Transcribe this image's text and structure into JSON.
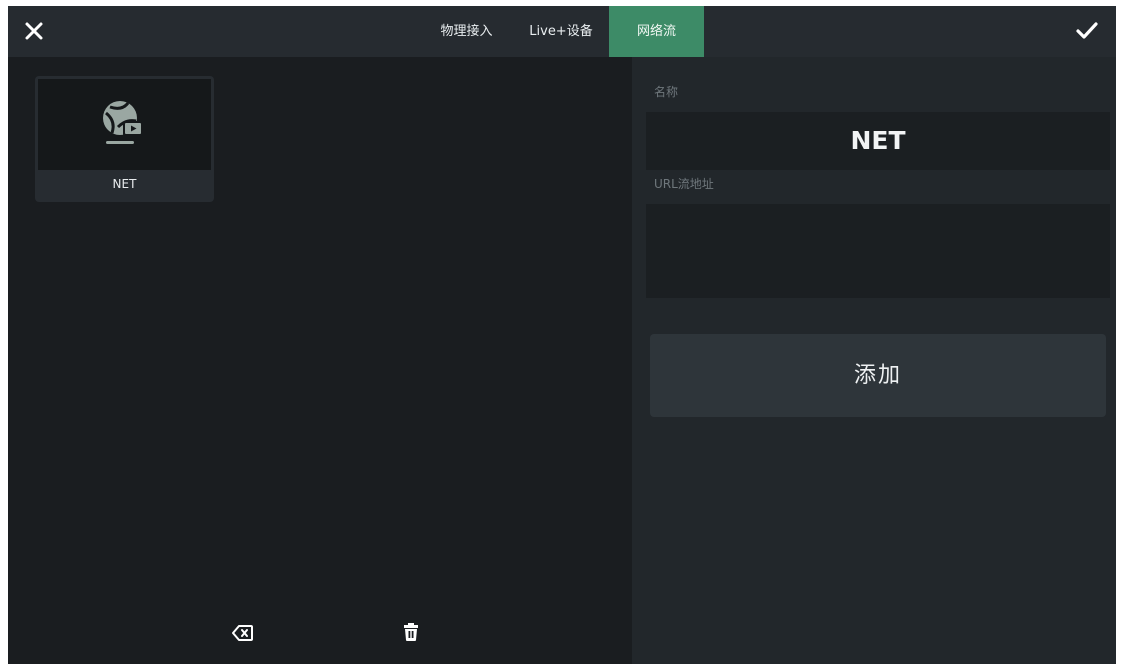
{
  "header": {
    "close_icon": "close-icon",
    "confirm_icon": "check-icon",
    "tabs": [
      {
        "label": "物理接入",
        "active": false
      },
      {
        "label": "Live+设备",
        "active": false
      },
      {
        "label": "网络流",
        "active": true
      }
    ]
  },
  "sources": {
    "items": [
      {
        "label": "NET",
        "icon": "network-stream-icon"
      }
    ]
  },
  "bottom_toolbar": {
    "backspace_icon": "backspace-icon",
    "delete_icon": "trash-icon"
  },
  "form": {
    "name_label": "名称",
    "name_value": "NET",
    "url_label": "URL流地址",
    "url_value": "",
    "add_button_label": "添加"
  },
  "colors": {
    "accent": "#3d8b67",
    "background": "#1b1f22",
    "panel": "#22272b",
    "topbar": "#262b30"
  }
}
